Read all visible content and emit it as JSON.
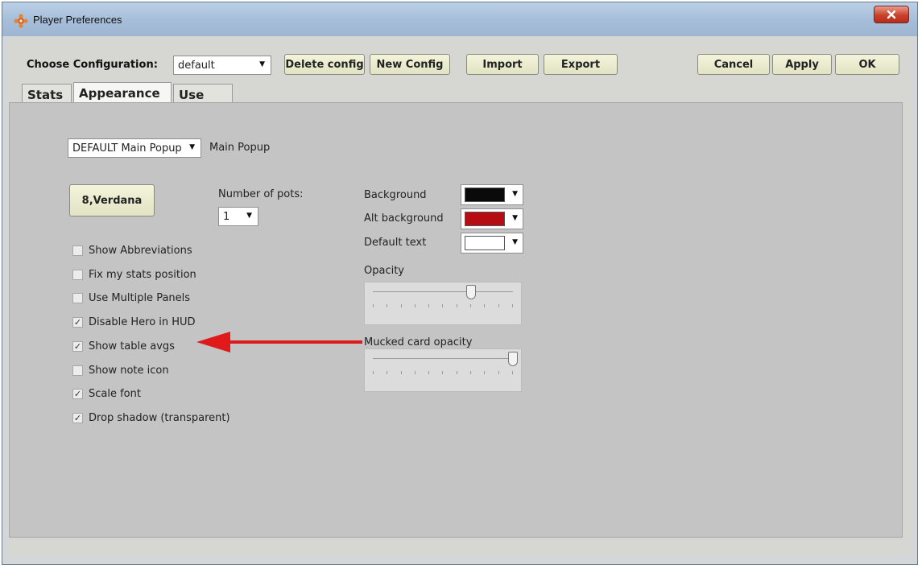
{
  "window": {
    "title": "Player Preferences"
  },
  "toolbar": {
    "choose_label": "Choose Configuration:",
    "config_value": "default",
    "delete_label": "Delete config",
    "new_label": "New Config",
    "import_label": "Import",
    "export_label": "Export",
    "cancel_label": "Cancel",
    "apply_label": "Apply",
    "ok_label": "OK"
  },
  "tabs": [
    {
      "label": "Stats",
      "active": false
    },
    {
      "label": "Appearance",
      "active": true
    },
    {
      "label": "Use for",
      "active": false
    }
  ],
  "appearance": {
    "popup_select": "DEFAULT Main Popup",
    "popup_label": "Main Popup",
    "font_button": "8,Verdana",
    "pots_label": "Number of pots:",
    "pots_value": "1",
    "checkboxes": [
      {
        "label": "Show Abbreviations",
        "checked": false
      },
      {
        "label": "Fix my stats position",
        "checked": false
      },
      {
        "label": "Use Multiple Panels",
        "checked": false
      },
      {
        "label": "Disable Hero in HUD",
        "checked": true
      },
      {
        "label": "Show table avgs",
        "checked": true
      },
      {
        "label": "Show note icon",
        "checked": false
      },
      {
        "label": "Scale font",
        "checked": true
      },
      {
        "label": "Drop shadow (transparent)",
        "checked": true
      }
    ],
    "colors": [
      {
        "label": "Background",
        "color": "#0a0a0a"
      },
      {
        "label": "Alt background",
        "color": "#b50d12"
      },
      {
        "label": "Default text",
        "color": "#ffffff"
      }
    ],
    "opacity_label": "Opacity",
    "opacity_value": 0.7,
    "mucked_label": "Mucked card opacity",
    "mucked_value": 1.0,
    "annotation_arrow_color": "#e0191b"
  }
}
